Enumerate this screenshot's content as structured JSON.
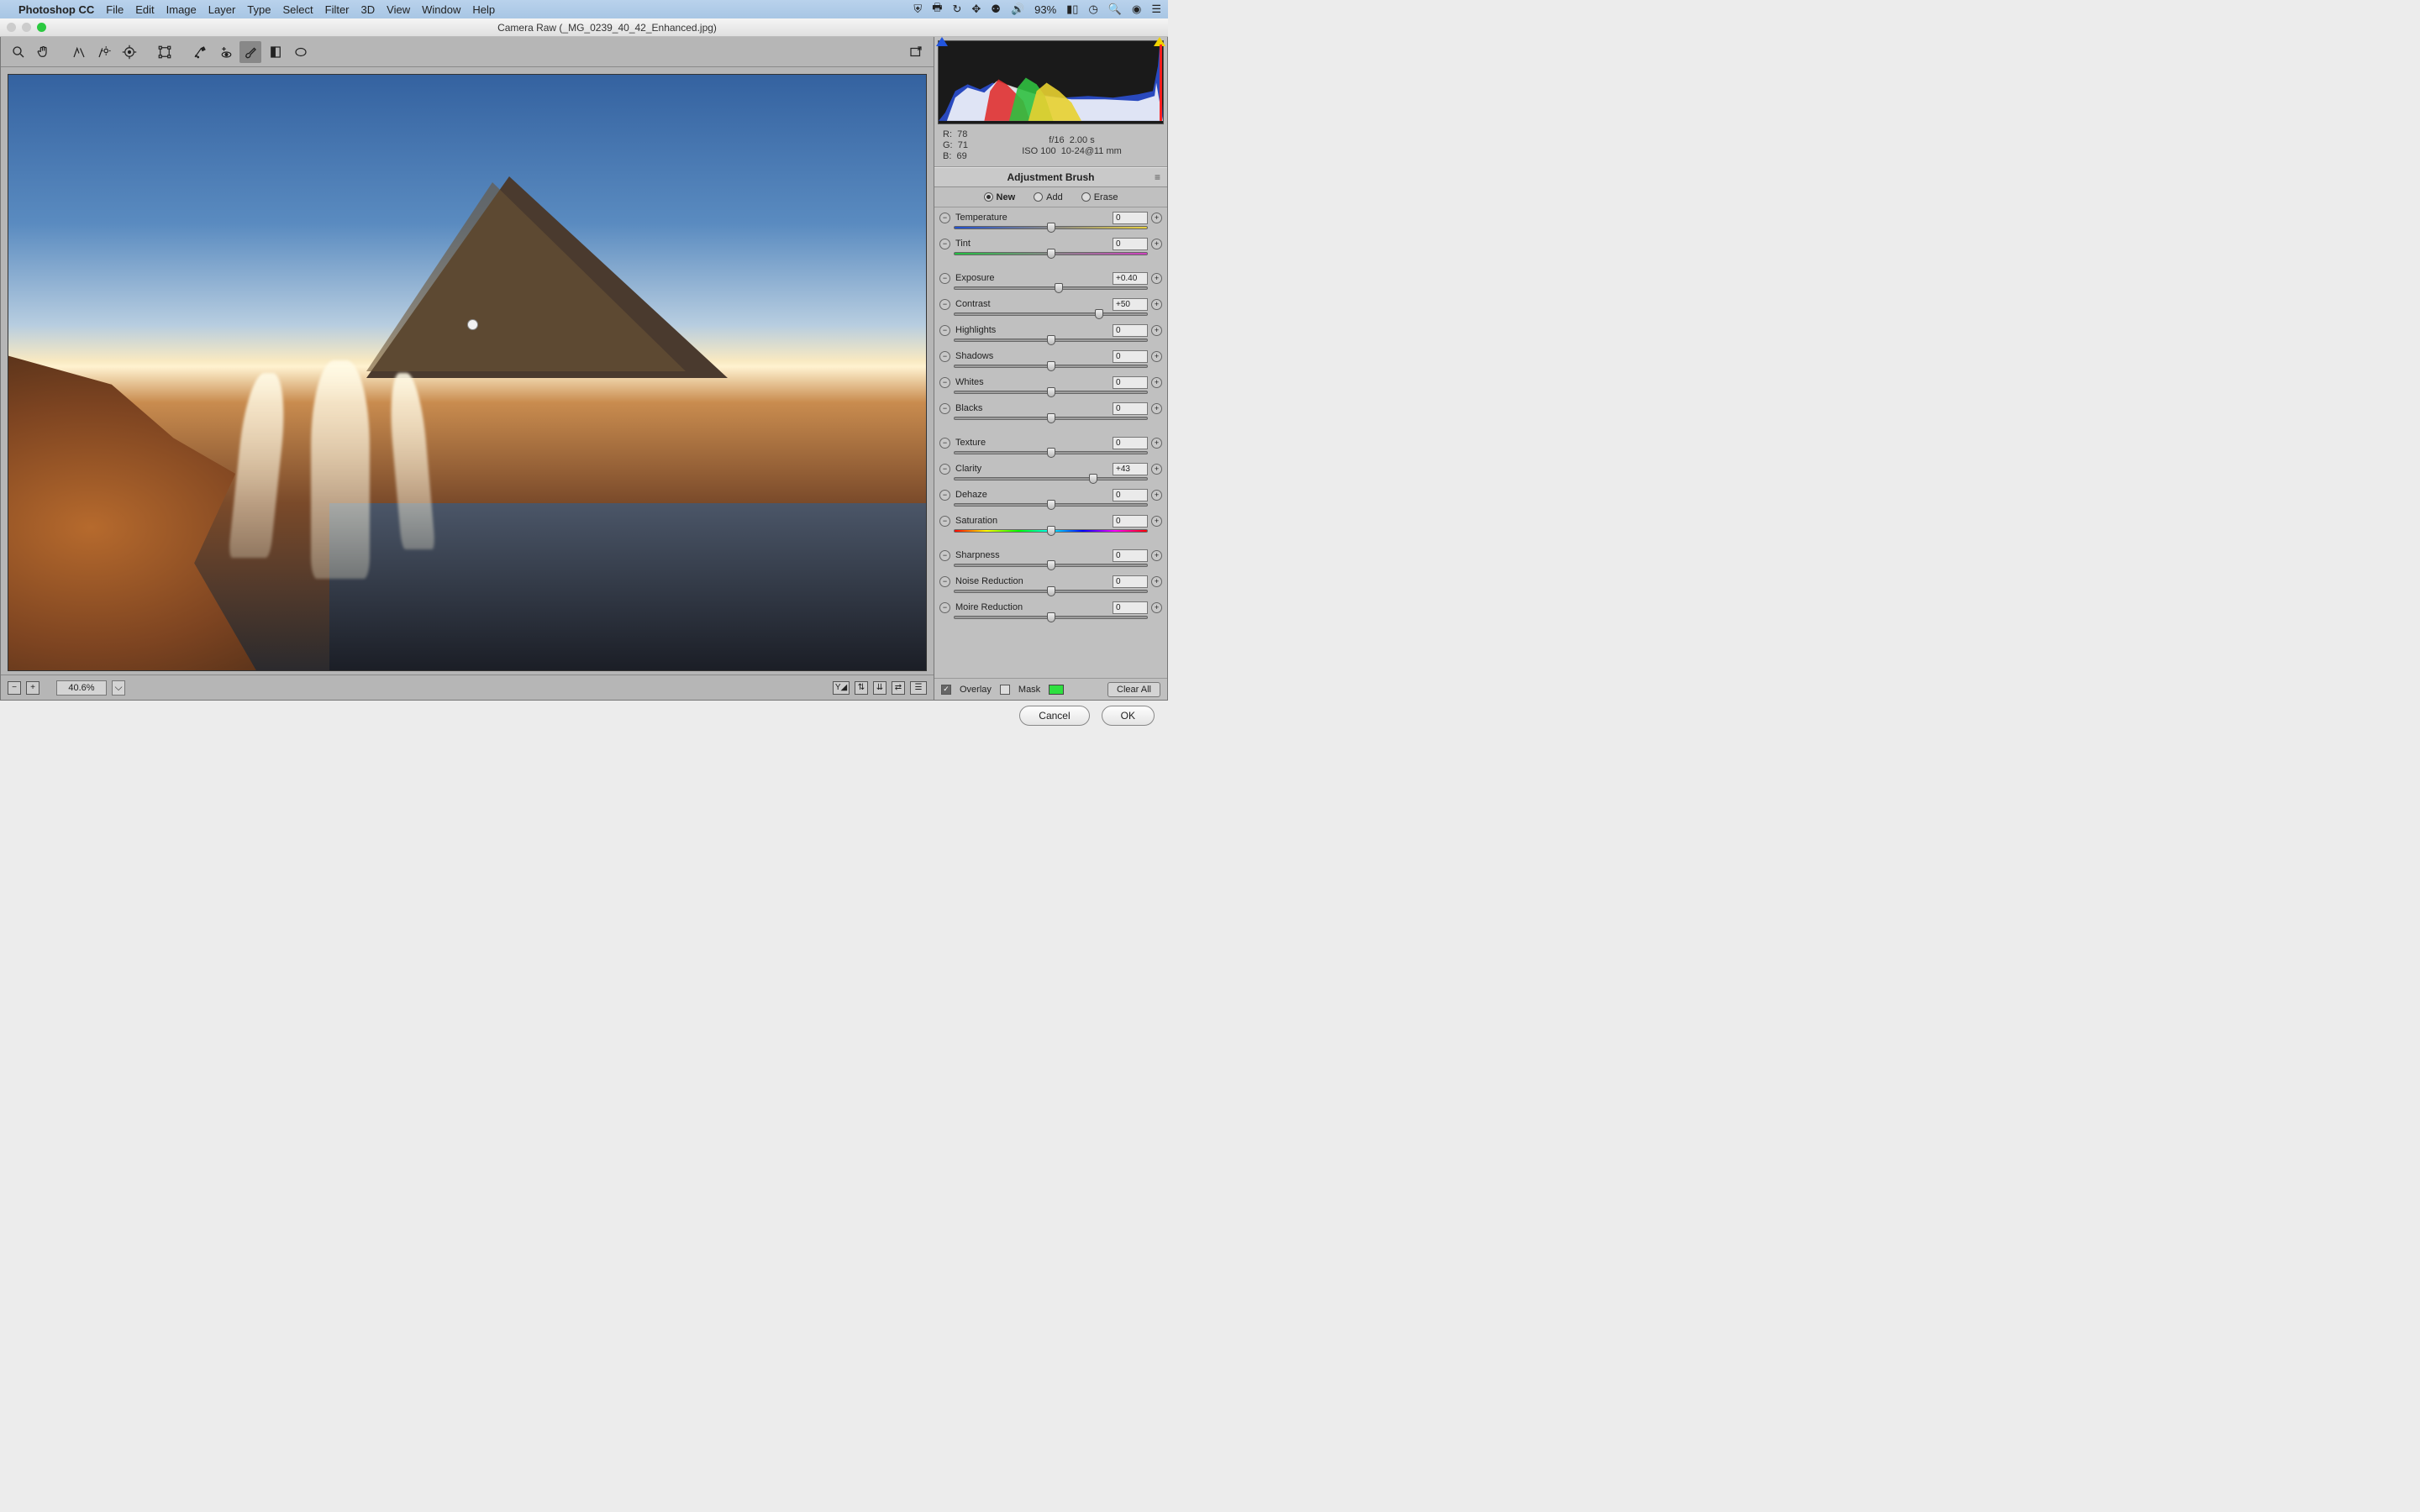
{
  "menubar": {
    "app": "Photoshop CC",
    "items": [
      "File",
      "Edit",
      "Image",
      "Layer",
      "Type",
      "Select",
      "Filter",
      "3D",
      "View",
      "Window",
      "Help"
    ],
    "battery": "93%"
  },
  "window": {
    "title": "Camera Raw (_MG_0239_40_42_Enhanced.jpg)"
  },
  "status": {
    "zoom": "40.6%"
  },
  "info": {
    "r_label": "R:",
    "r": "78",
    "g_label": "G:",
    "g": "71",
    "b_label": "B:",
    "b": "69",
    "aperture": "f/16",
    "shutter": "2.00 s",
    "iso": "ISO 100",
    "lens": "10-24@11 mm"
  },
  "panel": {
    "title": "Adjustment Brush",
    "modes": {
      "new": "New",
      "add": "Add",
      "erase": "Erase"
    }
  },
  "sliders": {
    "temperature": {
      "label": "Temperature",
      "value": "0",
      "pos": 50
    },
    "tint": {
      "label": "Tint",
      "value": "0",
      "pos": 50
    },
    "exposure": {
      "label": "Exposure",
      "value": "+0.40",
      "pos": 54
    },
    "contrast": {
      "label": "Contrast",
      "value": "+50",
      "pos": 75
    },
    "highlights": {
      "label": "Highlights",
      "value": "0",
      "pos": 50
    },
    "shadows": {
      "label": "Shadows",
      "value": "0",
      "pos": 50
    },
    "whites": {
      "label": "Whites",
      "value": "0",
      "pos": 50
    },
    "blacks": {
      "label": "Blacks",
      "value": "0",
      "pos": 50
    },
    "texture": {
      "label": "Texture",
      "value": "0",
      "pos": 50
    },
    "clarity": {
      "label": "Clarity",
      "value": "+43",
      "pos": 72
    },
    "dehaze": {
      "label": "Dehaze",
      "value": "0",
      "pos": 50
    },
    "saturation": {
      "label": "Saturation",
      "value": "0",
      "pos": 50
    },
    "sharpness": {
      "label": "Sharpness",
      "value": "0",
      "pos": 50
    },
    "noise": {
      "label": "Noise Reduction",
      "value": "0",
      "pos": 50
    },
    "moire": {
      "label": "Moire Reduction",
      "value": "0",
      "pos": 50
    }
  },
  "bottom": {
    "overlay": "Overlay",
    "mask": "Mask",
    "clear": "Clear All"
  },
  "footer": {
    "cancel": "Cancel",
    "ok": "OK"
  }
}
